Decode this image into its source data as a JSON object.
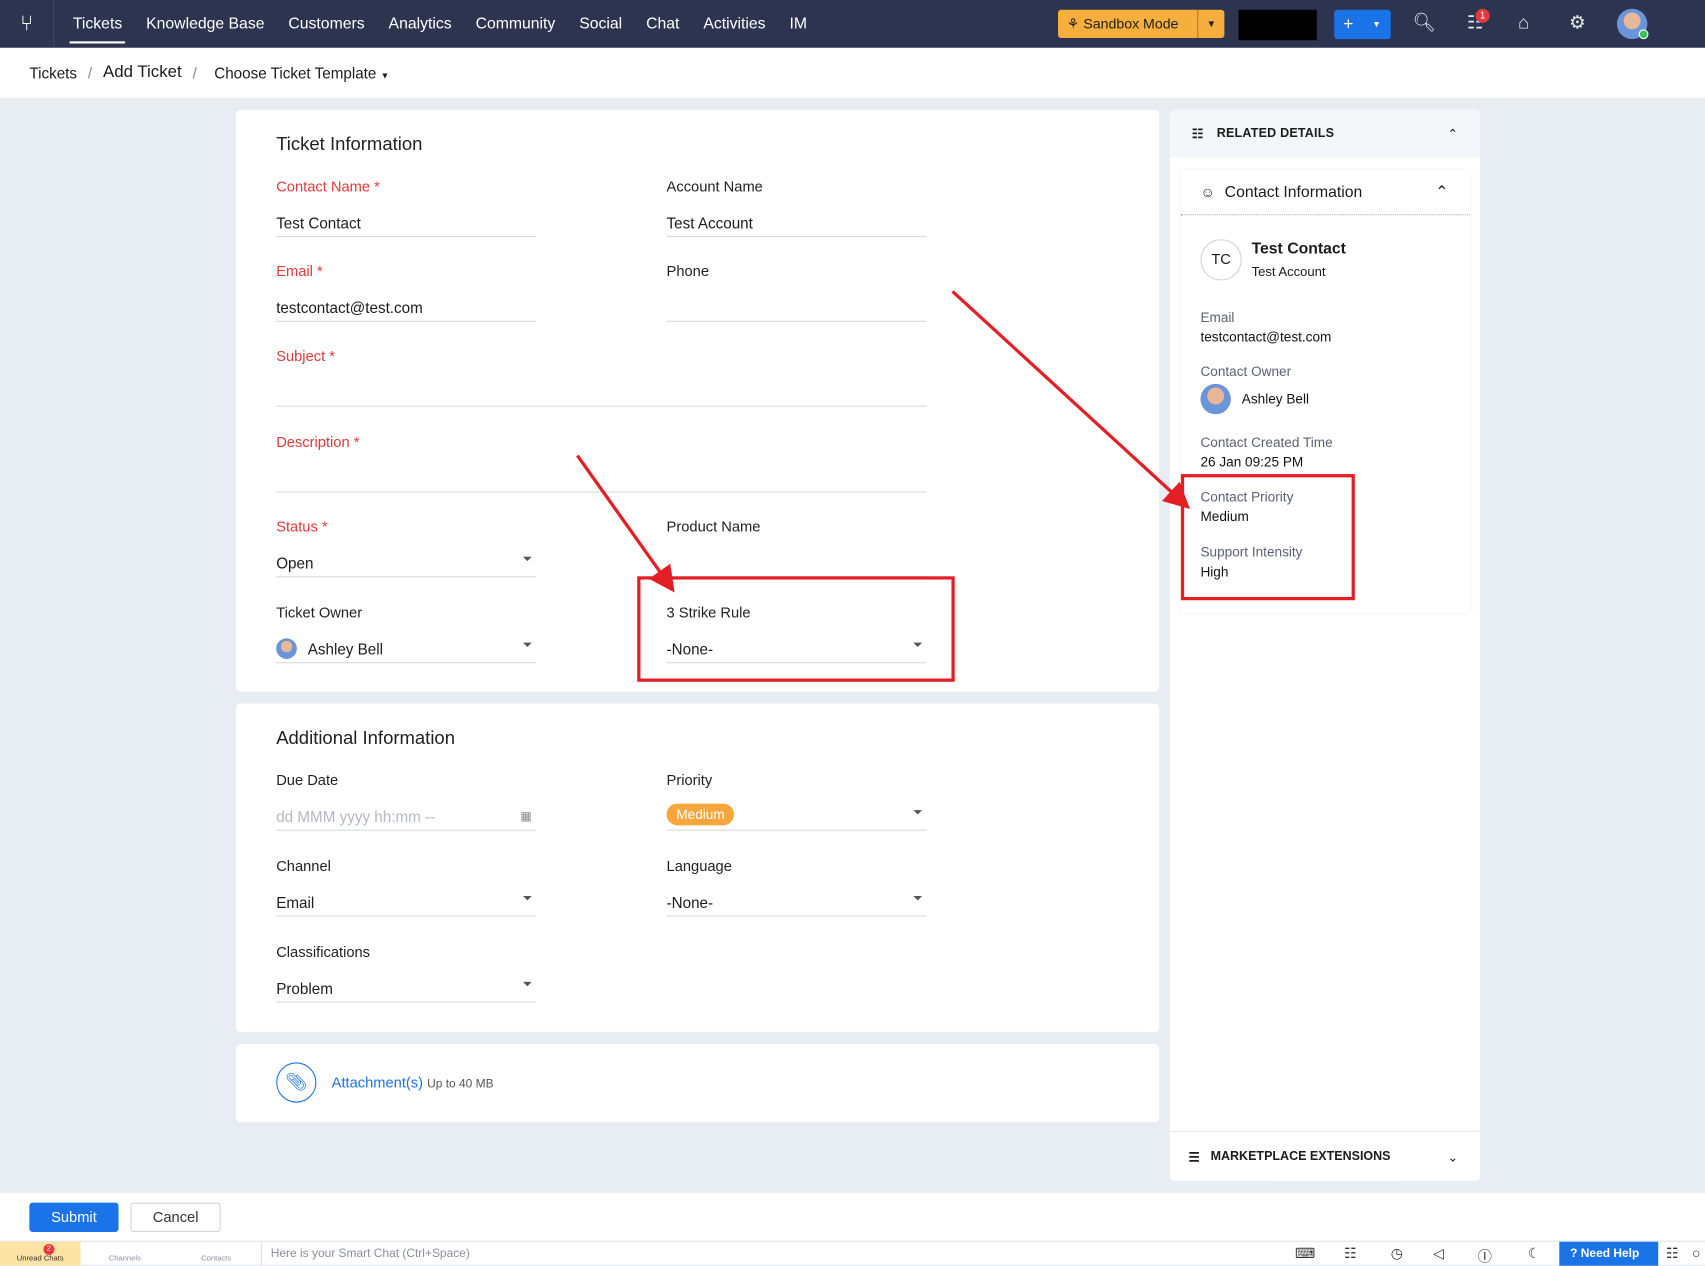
{
  "nav": {
    "items": [
      "Tickets",
      "Knowledge Base",
      "Customers",
      "Analytics",
      "Community",
      "Social",
      "Chat",
      "Activities",
      "IM"
    ],
    "active": "Tickets",
    "sandbox_label": "Sandbox Mode",
    "notification_count": "1"
  },
  "breadcrumb": {
    "root": "Tickets",
    "current": "Add Ticket",
    "template": "Choose Ticket Template"
  },
  "ticket_info": {
    "title": "Ticket Information",
    "contact_name": {
      "label": "Contact Name",
      "value": "Test Contact"
    },
    "account_name": {
      "label": "Account Name",
      "value": "Test Account"
    },
    "email": {
      "label": "Email",
      "value": "testcontact@test.com"
    },
    "phone": {
      "label": "Phone",
      "value": ""
    },
    "subject": {
      "label": "Subject",
      "value": ""
    },
    "description": {
      "label": "Description",
      "value": ""
    },
    "status": {
      "label": "Status",
      "value": "Open"
    },
    "product_name": {
      "label": "Product Name",
      "value": ""
    },
    "ticket_owner": {
      "label": "Ticket Owner",
      "value": "Ashley Bell"
    },
    "strike_rule": {
      "label": "3 Strike Rule",
      "value": "-None-"
    }
  },
  "additional_info": {
    "title": "Additional Information",
    "due_date": {
      "label": "Due Date",
      "placeholder": "dd MMM yyyy hh:mm --"
    },
    "priority": {
      "label": "Priority",
      "value": "Medium"
    },
    "channel": {
      "label": "Channel",
      "value": "Email"
    },
    "language": {
      "label": "Language",
      "value": "-None-"
    },
    "classifications": {
      "label": "Classifications",
      "value": "Problem"
    }
  },
  "attachments": {
    "label": "Attachment(s)",
    "limit": "Up to 40 MB"
  },
  "related": {
    "title": "RELATED DETAILS",
    "contact_section": "Contact Information",
    "initials": "TC",
    "name": "Test Contact",
    "account": "Test Account",
    "fields": [
      {
        "k": "Email",
        "v": "testcontact@test.com"
      },
      {
        "k": "Contact Owner",
        "v": "Ashley Bell"
      },
      {
        "k": "Contact Created Time",
        "v": "26 Jan 09:25 PM"
      },
      {
        "k": "Contact Priority",
        "v": "Medium"
      },
      {
        "k": "Support Intensity",
        "v": "High"
      }
    ],
    "marketplace": "MARKETPLACE EXTENSIONS"
  },
  "footer": {
    "submit": "Submit",
    "cancel": "Cancel"
  },
  "bottom": {
    "unread": "Unread Chats",
    "unread_count": "2",
    "channels": "Channels",
    "contacts": "Contacts",
    "smart_chat": "Here is your Smart Chat (Ctrl+Space)",
    "need_help": "Need Help"
  },
  "colors": {
    "topbar": "#2c3450",
    "accent": "#1a74e8",
    "sandbox": "#f6ae3c",
    "required": "#e2393b",
    "highlight": "#e31e24"
  }
}
